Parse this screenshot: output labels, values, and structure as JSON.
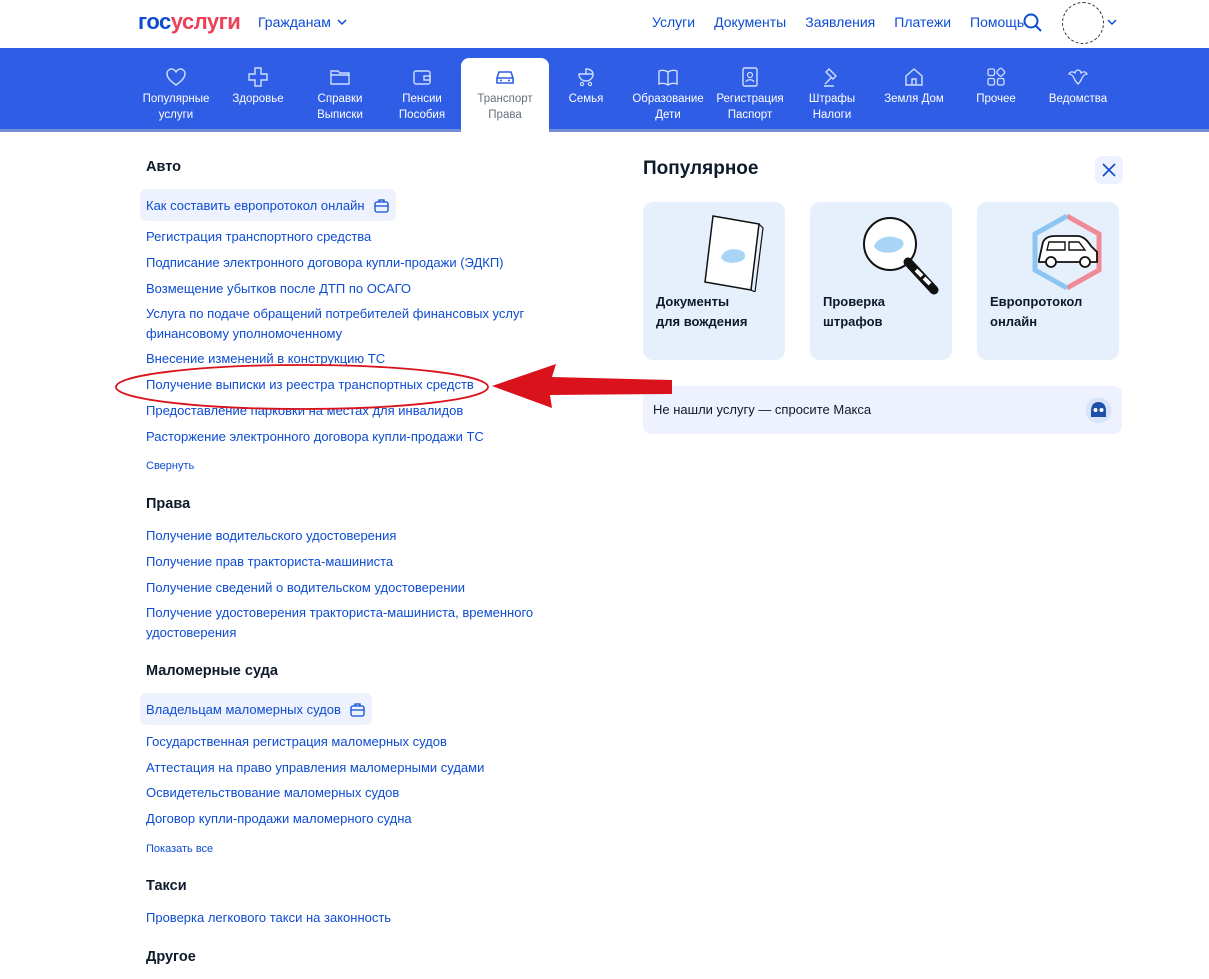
{
  "header": {
    "logo_part1": "гос",
    "logo_part2": "услуги",
    "audience": "Гражданам",
    "nav": [
      "Услуги",
      "Документы",
      "Заявления",
      "Платежи",
      "Помощь"
    ]
  },
  "categories": [
    {
      "line1": "Популярные",
      "line2": "услуги",
      "icon": "heart-icon"
    },
    {
      "line1": "Здоровье",
      "line2": "",
      "icon": "plus-cross-icon"
    },
    {
      "line1": "Справки",
      "line2": "Выписки",
      "icon": "folder-icon"
    },
    {
      "line1": "Пенсии",
      "line2": "Пособия",
      "icon": "wallet-icon"
    },
    {
      "line1": "Транспорт",
      "line2": "Права",
      "icon": "car-icon",
      "active": true
    },
    {
      "line1": "Семья",
      "line2": "",
      "icon": "stroller-icon"
    },
    {
      "line1": "Образование",
      "line2": "Дети",
      "icon": "book-icon"
    },
    {
      "line1": "Регистрация",
      "line2": "Паспорт",
      "icon": "passport-icon"
    },
    {
      "line1": "Штрафы",
      "line2": "Налоги",
      "icon": "gavel-icon"
    },
    {
      "line1": "Земля Дом",
      "line2": "",
      "icon": "house-icon"
    },
    {
      "line1": "Прочее",
      "line2": "",
      "icon": "grid-icon"
    },
    {
      "line1": "Ведомства",
      "line2": "",
      "icon": "eagle-icon"
    }
  ],
  "sections": {
    "auto": {
      "title": "Авто",
      "featured": "Как составить европротокол онлайн",
      "links": [
        "Регистрация транспортного средства",
        "Подписание электронного договора купли-продажи (ЭДКП)",
        "Возмещение убытков после ДТП по ОСАГО",
        "Услуга по подаче обращений потребителей финансовых услуг финансовому уполномоченному",
        "Внесение изменений в конструкцию ТС",
        "Получение выписки из реестра транспортных средств",
        "Предоставление парковки на местах для инвалидов",
        "Расторжение электронного договора купли-продажи ТС"
      ],
      "toggle": "Свернуть"
    },
    "rights": {
      "title": "Права",
      "links": [
        "Получение водительского удостоверения",
        "Получение прав тракториста-машиниста",
        "Получение сведений о водительском удостоверении",
        "Получение удостоверения тракториста-машиниста, временного удостоверения"
      ]
    },
    "boats": {
      "title": "Маломерные суда",
      "featured": "Владельцам маломерных судов",
      "links": [
        "Государственная регистрация маломерных судов",
        "Аттестация на право управления маломерными судами",
        "Освидетельствование маломерных судов",
        "Договор купли-продажи маломерного судна"
      ],
      "toggle": "Показать все"
    },
    "taxi": {
      "title": "Такси",
      "links": [
        "Проверка легкового такси на законность"
      ]
    },
    "other": {
      "title": "Другое"
    }
  },
  "popular": {
    "title": "Популярное",
    "cards": [
      {
        "line1": "Документы",
        "line2": "для вождения"
      },
      {
        "line1": "Проверка",
        "line2": "штрафов"
      },
      {
        "line1": "Европротокол",
        "line2": "онлайн"
      }
    ],
    "ask_text": "Не нашли услугу — спросите Макса"
  },
  "colors": {
    "brand_blue": "#0d4cd3",
    "brand_red": "#ee3f58",
    "category_bar": "#2f5de6",
    "annotation_red": "#d9121c"
  }
}
